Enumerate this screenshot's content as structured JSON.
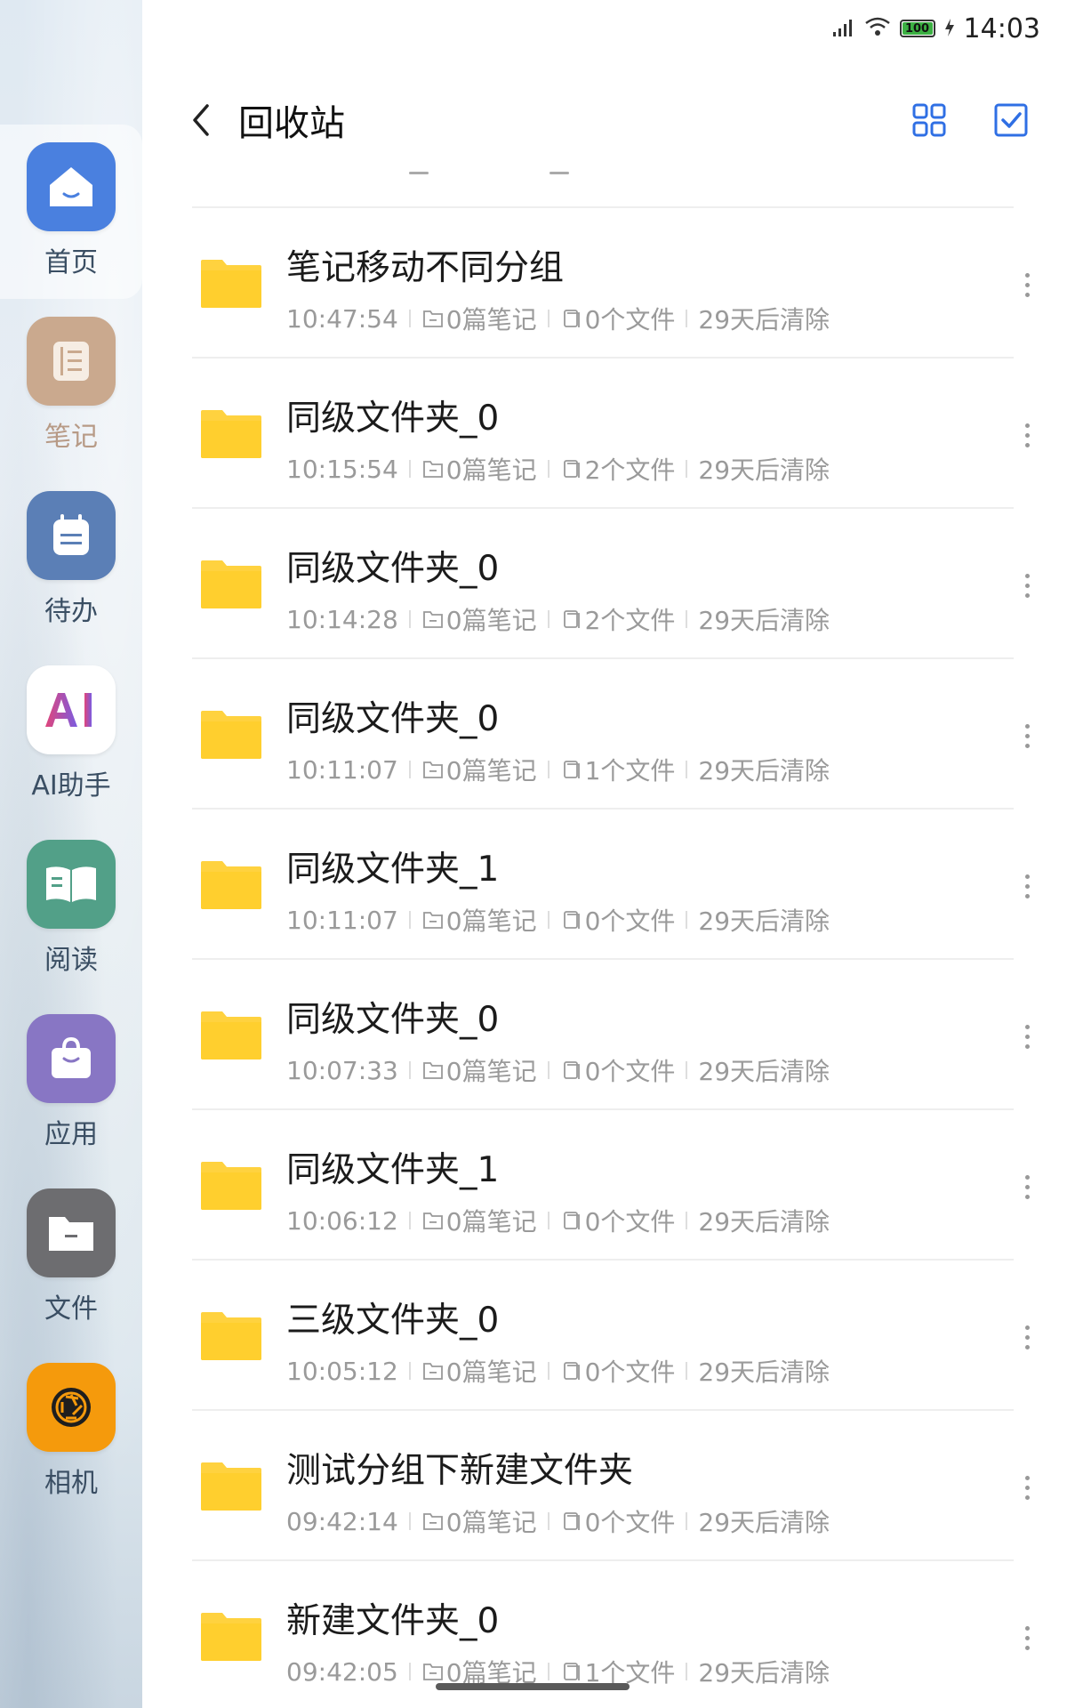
{
  "status": {
    "battery": "100",
    "time": "14:03"
  },
  "header": {
    "title": "回收站"
  },
  "sidebar": {
    "items": [
      {
        "label": "首页",
        "icon": "home-icon",
        "color": "#4a80df"
      },
      {
        "label": "笔记",
        "icon": "notebook-icon",
        "color": "#caa98e"
      },
      {
        "label": "待办",
        "icon": "todo-icon",
        "color": "#5b7fb6"
      },
      {
        "label": "AI助手",
        "icon": "ai-icon",
        "color": "#ffffff"
      },
      {
        "label": "阅读",
        "icon": "book-icon",
        "color": "#52a088"
      },
      {
        "label": "应用",
        "icon": "bag-icon",
        "color": "#8876c4"
      },
      {
        "label": "文件",
        "icon": "folder-icon",
        "color": "#6d6d70"
      },
      {
        "label": "相机",
        "icon": "camera-icon",
        "color": "#f59a0c"
      }
    ]
  },
  "items": [
    {
      "title": "笔记移动不同分组",
      "time": "10:47:54",
      "notes": "0篇笔记",
      "files": "0个文件",
      "expire": "29天后清除"
    },
    {
      "title": "同级文件夹_0",
      "time": "10:15:54",
      "notes": "0篇笔记",
      "files": "2个文件",
      "expire": "29天后清除"
    },
    {
      "title": "同级文件夹_0",
      "time": "10:14:28",
      "notes": "0篇笔记",
      "files": "2个文件",
      "expire": "29天后清除"
    },
    {
      "title": "同级文件夹_0",
      "time": "10:11:07",
      "notes": "0篇笔记",
      "files": "1个文件",
      "expire": "29天后清除"
    },
    {
      "title": "同级文件夹_1",
      "time": "10:11:07",
      "notes": "0篇笔记",
      "files": "0个文件",
      "expire": "29天后清除"
    },
    {
      "title": "同级文件夹_0",
      "time": "10:07:33",
      "notes": "0篇笔记",
      "files": "0个文件",
      "expire": "29天后清除"
    },
    {
      "title": "同级文件夹_1",
      "time": "10:06:12",
      "notes": "0篇笔记",
      "files": "0个文件",
      "expire": "29天后清除"
    },
    {
      "title": "三级文件夹_0",
      "time": "10:05:12",
      "notes": "0篇笔记",
      "files": "0个文件",
      "expire": "29天后清除"
    },
    {
      "title": "测试分组下新建文件夹",
      "time": "09:42:14",
      "notes": "0篇笔记",
      "files": "0个文件",
      "expire": "29天后清除"
    },
    {
      "title": "新建文件夹_0",
      "time": "09:42:05",
      "notes": "0篇笔记",
      "files": "1个文件",
      "expire": "29天后清除"
    }
  ],
  "colors": {
    "folder": "#ffd23f",
    "accent": "#2f6fe4"
  }
}
